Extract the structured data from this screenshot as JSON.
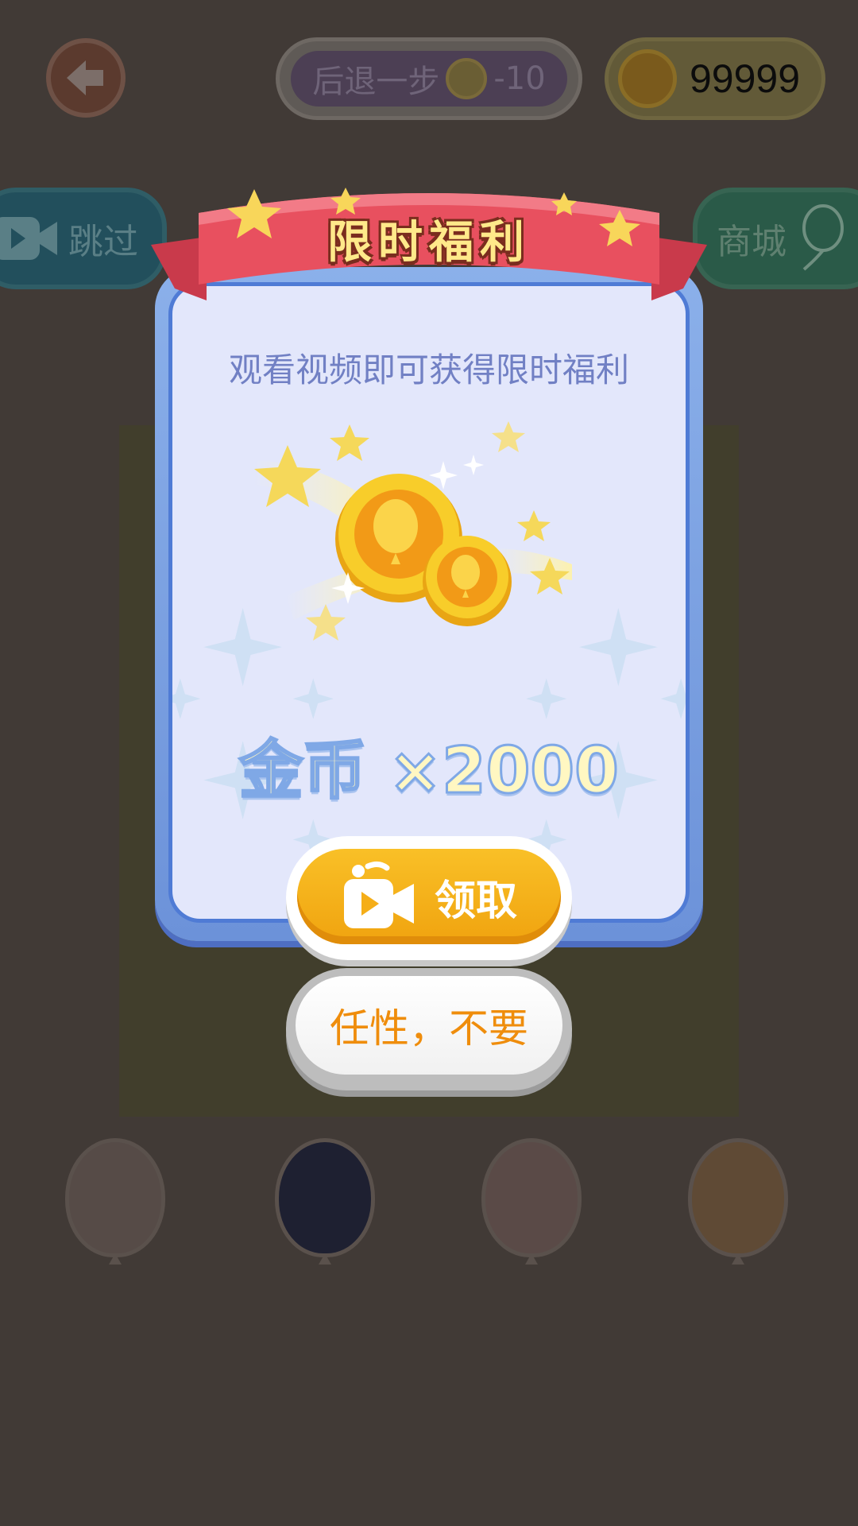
{
  "topbar": {
    "undo_label": "后退一步",
    "undo_cost": "-10",
    "coins": "99999"
  },
  "side_buttons": {
    "skip_label": "跳过",
    "shop_label": "商城"
  },
  "modal": {
    "title": "限时福利",
    "subtitle": "观看视频即可获得限时福利",
    "reward": "金币 ×2000",
    "claim_label": "领取",
    "refuse_label": "任性，不要"
  },
  "colors": {
    "ribbon": "#e8505f",
    "claim_button": "#f5ae18",
    "refuse_text": "#ef8d0c",
    "modal_bg": "#e3e7fb"
  },
  "icons": [
    "back-arrow-icon",
    "balloon-coin-icon",
    "video-camera-icon",
    "balloon-icon"
  ]
}
